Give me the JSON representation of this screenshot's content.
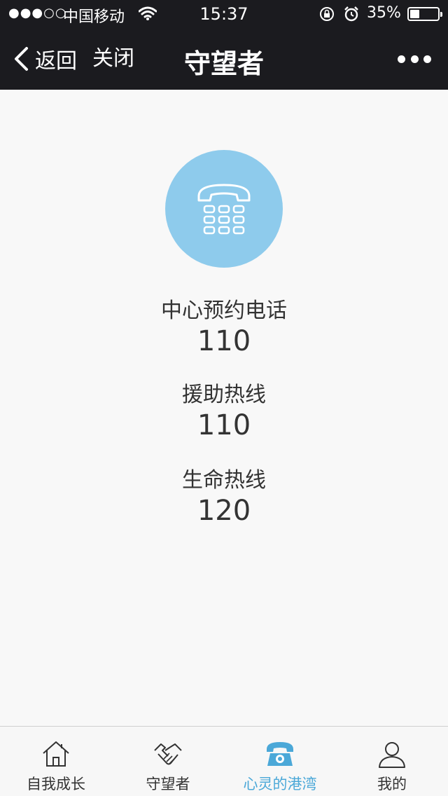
{
  "status_bar": {
    "signal": "●●●○○",
    "carrier": "中国移动",
    "time": "15:37",
    "battery_percent": "35%",
    "battery_level": 0.35
  },
  "nav": {
    "back_label": "返回",
    "close_label": "关闭",
    "title": "守望者"
  },
  "hotlines": [
    {
      "label": "中心预约电话",
      "number": "110"
    },
    {
      "label": "援助热线",
      "number": "110"
    },
    {
      "label": "生命热线",
      "number": "120"
    }
  ],
  "tabs": [
    {
      "label": "自我成长",
      "icon": "home-icon",
      "active": false
    },
    {
      "label": "守望者",
      "icon": "handshake-icon",
      "active": false
    },
    {
      "label": "心灵的港湾",
      "icon": "telephone-icon",
      "active": true
    },
    {
      "label": "我的",
      "icon": "person-icon",
      "active": false
    }
  ],
  "colors": {
    "top_bar": "#1b1b1f",
    "accent": "#4ba8d8",
    "circle": "#8ecbec"
  }
}
